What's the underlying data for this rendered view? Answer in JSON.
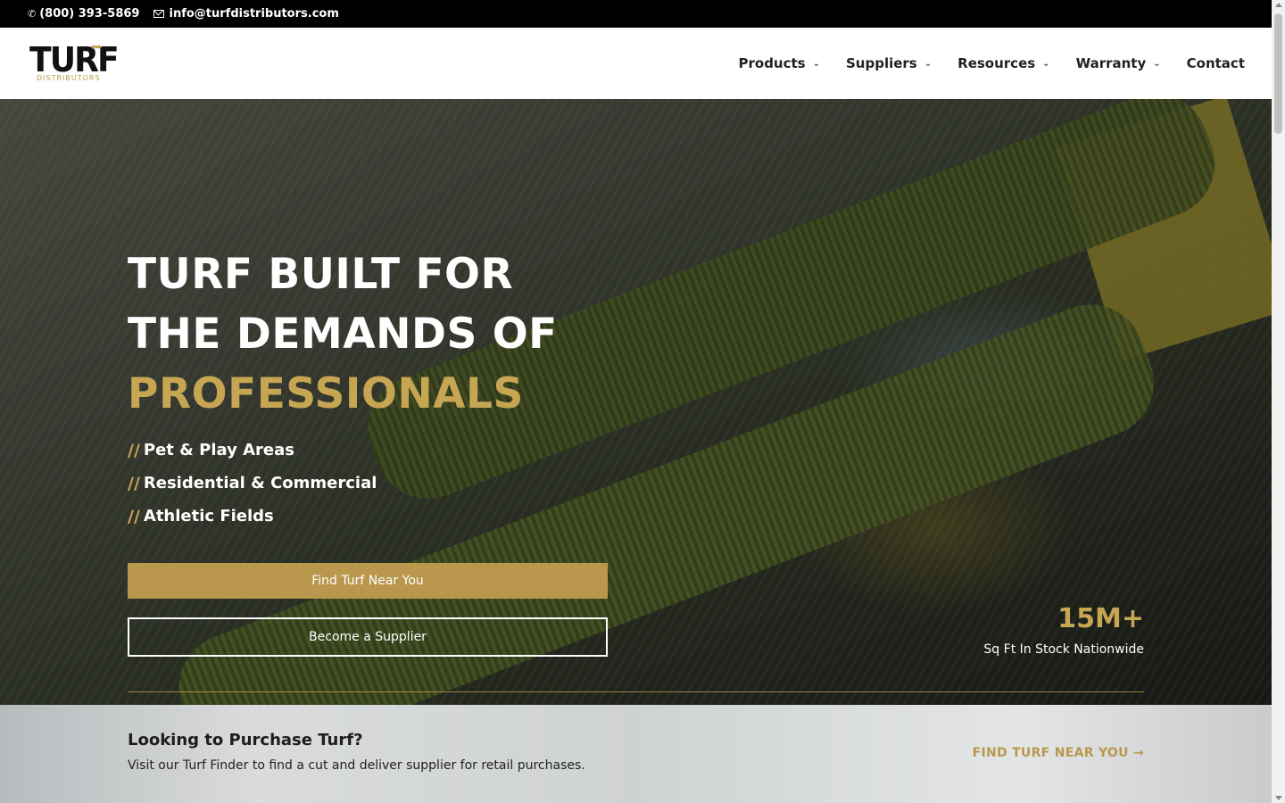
{
  "topbar": {
    "phone": "(800) 393-5869",
    "email": "info@turfdistributors.com",
    "phone_icon": "phone-icon",
    "email_icon": "envelope-icon"
  },
  "header": {
    "logo_word": "TURF",
    "logo_sub": "DISTRIBUTORS",
    "nav": [
      {
        "label": "Products",
        "has_dropdown": true
      },
      {
        "label": "Suppliers",
        "has_dropdown": true
      },
      {
        "label": "Resources",
        "has_dropdown": true
      },
      {
        "label": "Warranty",
        "has_dropdown": true
      },
      {
        "label": "Contact",
        "has_dropdown": false
      }
    ]
  },
  "hero": {
    "headline_line1": "TURF BUILT FOR",
    "headline_line2": "THE DEMANDS OF",
    "headline_accent": "PROFESSIONALS",
    "bullets": [
      {
        "prefix": "//",
        "text": "Pet & Play Areas"
      },
      {
        "prefix": "//",
        "text": "Residential & Commercial"
      },
      {
        "prefix": "//",
        "text": "Athletic Fields"
      }
    ],
    "primary_button": "Find Turf Near You",
    "secondary_button": "Become a Supplier",
    "stat_value": "15M+",
    "stat_label": "Sq Ft In Stock Nationwide"
  },
  "band": {
    "title": "Looking to Purchase Turf?",
    "description": "Visit our Turf Finder to find a cut and deliver supplier for retail purchases.",
    "cta": "FIND TURF NEAR YOU →"
  },
  "colors": {
    "accent": "#b9984d",
    "topbar_bg": "#000000",
    "header_bg": "#ffffff"
  }
}
